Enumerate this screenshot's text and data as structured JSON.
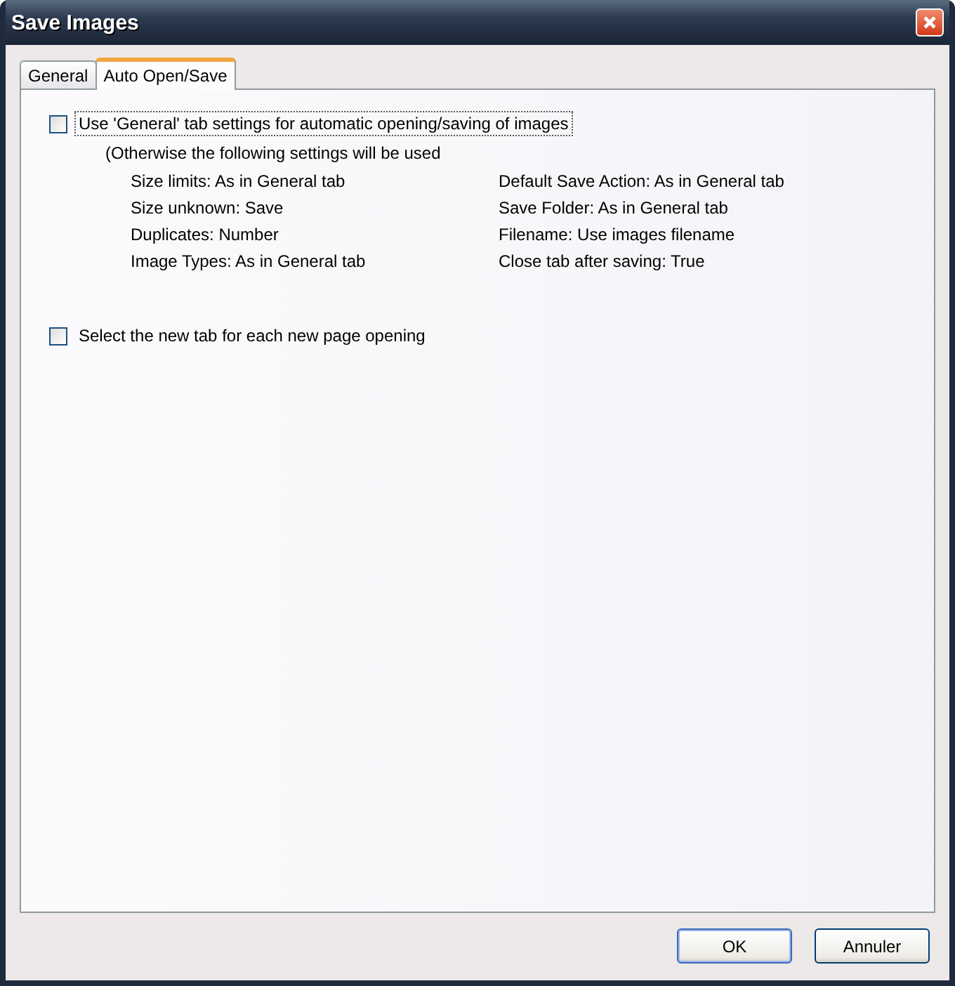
{
  "window": {
    "title": "Save Images"
  },
  "tabs": [
    {
      "label": "General",
      "selected": false
    },
    {
      "label": "Auto Open/Save",
      "selected": true
    }
  ],
  "options": [
    {
      "label": "Use 'General' tab settings for automatic opening/saving of images",
      "checked": false,
      "focused": true
    },
    {
      "label": "Select the new tab for each new page opening",
      "checked": false,
      "focused": false
    }
  ],
  "note": "(Otherwise the following settings will be used",
  "settings": {
    "left": [
      "Size limits: As in General tab",
      "Size unknown: Save",
      "Duplicates: Number",
      "Image Types: As in General tab"
    ],
    "right": [
      "Default Save Action: As in General tab",
      "Save Folder: As in General tab",
      "Filename: Use images filename",
      "Close tab after saving: True"
    ]
  },
  "buttons": [
    {
      "label": "OK",
      "default": true
    },
    {
      "label": "Annuler",
      "default": false
    }
  ]
}
